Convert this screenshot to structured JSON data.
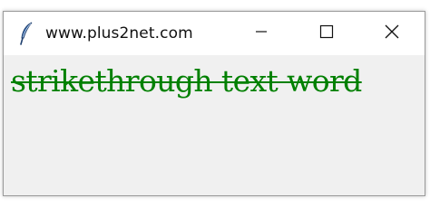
{
  "window": {
    "title": "www.plus2net.com",
    "app_icon": "feather-icon",
    "controls": {
      "minimize_icon": "minimize-icon",
      "maximize_icon": "maximize-icon",
      "close_icon": "close-icon"
    }
  },
  "content": {
    "label_text": "strikethrough text word",
    "label_color": "#008000",
    "label_style": "strikethrough"
  }
}
